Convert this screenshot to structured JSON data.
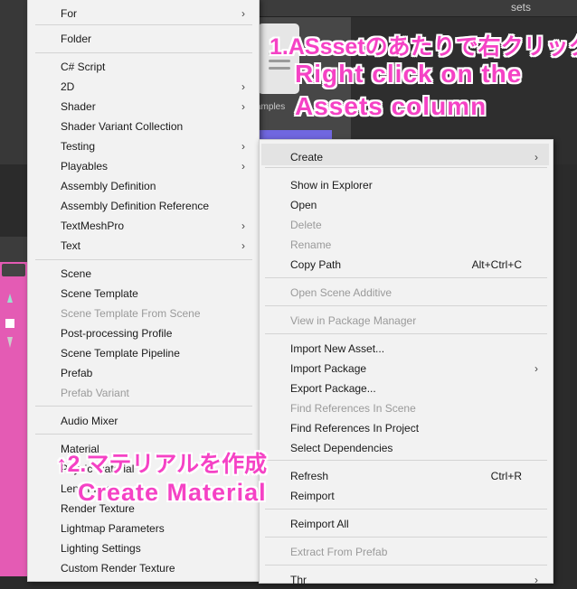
{
  "background": {
    "panel_header": "sets",
    "folder_label": "amples"
  },
  "left_menu": {
    "items": [
      {
        "label": "For",
        "arrow": true,
        "disabled": false
      },
      {
        "label": "Folder",
        "arrow": false,
        "disabled": false
      },
      {
        "label": "C# Script",
        "arrow": false,
        "disabled": false
      },
      {
        "label": "2D",
        "arrow": true,
        "disabled": false
      },
      {
        "label": "Shader",
        "arrow": true,
        "disabled": false
      },
      {
        "label": "Shader Variant Collection",
        "arrow": false,
        "disabled": false
      },
      {
        "label": "Testing",
        "arrow": true,
        "disabled": false
      },
      {
        "label": "Playables",
        "arrow": true,
        "disabled": false
      },
      {
        "label": "Assembly Definition",
        "arrow": false,
        "disabled": false
      },
      {
        "label": "Assembly Definition Reference",
        "arrow": false,
        "disabled": false
      },
      {
        "label": "TextMeshPro",
        "arrow": true,
        "disabled": false
      },
      {
        "label": "Text",
        "arrow": true,
        "disabled": false
      },
      {
        "label": "Scene",
        "arrow": false,
        "disabled": false
      },
      {
        "label": "Scene Template",
        "arrow": false,
        "disabled": false
      },
      {
        "label": "Scene Template From Scene",
        "arrow": false,
        "disabled": true
      },
      {
        "label": "Post-processing Profile",
        "arrow": false,
        "disabled": false
      },
      {
        "label": "Scene Template Pipeline",
        "arrow": false,
        "disabled": false
      },
      {
        "label": "Prefab",
        "arrow": false,
        "disabled": false
      },
      {
        "label": "Prefab Variant",
        "arrow": false,
        "disabled": true
      },
      {
        "label": "Audio Mixer",
        "arrow": false,
        "disabled": false
      },
      {
        "label": "Material",
        "arrow": false,
        "disabled": false
      },
      {
        "label": "Physic Material",
        "arrow": false,
        "disabled": false
      },
      {
        "label": "Lens Flare",
        "arrow": false,
        "disabled": false
      },
      {
        "label": "Render Texture",
        "arrow": false,
        "disabled": false
      },
      {
        "label": "Lightmap Parameters",
        "arrow": false,
        "disabled": false
      },
      {
        "label": "Lighting Settings",
        "arrow": false,
        "disabled": false
      },
      {
        "label": "Custom Render Texture",
        "arrow": false,
        "disabled": false
      }
    ]
  },
  "right_menu": {
    "items": [
      {
        "label": "Create",
        "arrow": true,
        "shortcut": "",
        "disabled": false
      },
      {
        "label": "Show in Explorer",
        "arrow": false,
        "shortcut": "",
        "disabled": false
      },
      {
        "label": "Open",
        "arrow": false,
        "shortcut": "",
        "disabled": false
      },
      {
        "label": "Delete",
        "arrow": false,
        "shortcut": "",
        "disabled": true
      },
      {
        "label": "Rename",
        "arrow": false,
        "shortcut": "",
        "disabled": true
      },
      {
        "label": "Copy Path",
        "arrow": false,
        "shortcut": "Alt+Ctrl+C",
        "disabled": false
      },
      {
        "label": "Open Scene Additive",
        "arrow": false,
        "shortcut": "",
        "disabled": true
      },
      {
        "label": "View in Package Manager",
        "arrow": false,
        "shortcut": "",
        "disabled": true
      },
      {
        "label": "Import New Asset...",
        "arrow": false,
        "shortcut": "",
        "disabled": false
      },
      {
        "label": "Import Package",
        "arrow": true,
        "shortcut": "",
        "disabled": false
      },
      {
        "label": "Export Package...",
        "arrow": false,
        "shortcut": "",
        "disabled": false
      },
      {
        "label": "Find References In Scene",
        "arrow": false,
        "shortcut": "",
        "disabled": true
      },
      {
        "label": "Find References In Project",
        "arrow": false,
        "shortcut": "",
        "disabled": false
      },
      {
        "label": "Select Dependencies",
        "arrow": false,
        "shortcut": "",
        "disabled": false
      },
      {
        "label": "Refresh",
        "arrow": false,
        "shortcut": "Ctrl+R",
        "disabled": false
      },
      {
        "label": "Reimport",
        "arrow": false,
        "shortcut": "",
        "disabled": false
      },
      {
        "label": "Reimport All",
        "arrow": false,
        "shortcut": "",
        "disabled": false
      },
      {
        "label": "Extract From Prefab",
        "arrow": false,
        "shortcut": "",
        "disabled": true
      },
      {
        "label": "Thr",
        "arrow": true,
        "shortcut": "",
        "disabled": false
      }
    ]
  },
  "annotations": {
    "step1_jp": "1.ASssetのあたりで右クリック",
    "step1_en_line1": "Right click on the",
    "step1_en_line2": "Assets column",
    "step2_jp": "↑2.マテリアルを作成",
    "step2_en": "Create Material"
  },
  "colors": {
    "annotation": "#f542c5",
    "menu_bg": "#f2f2f2",
    "selected_asset": "#7067e0"
  },
  "arrow_glyph": "›"
}
